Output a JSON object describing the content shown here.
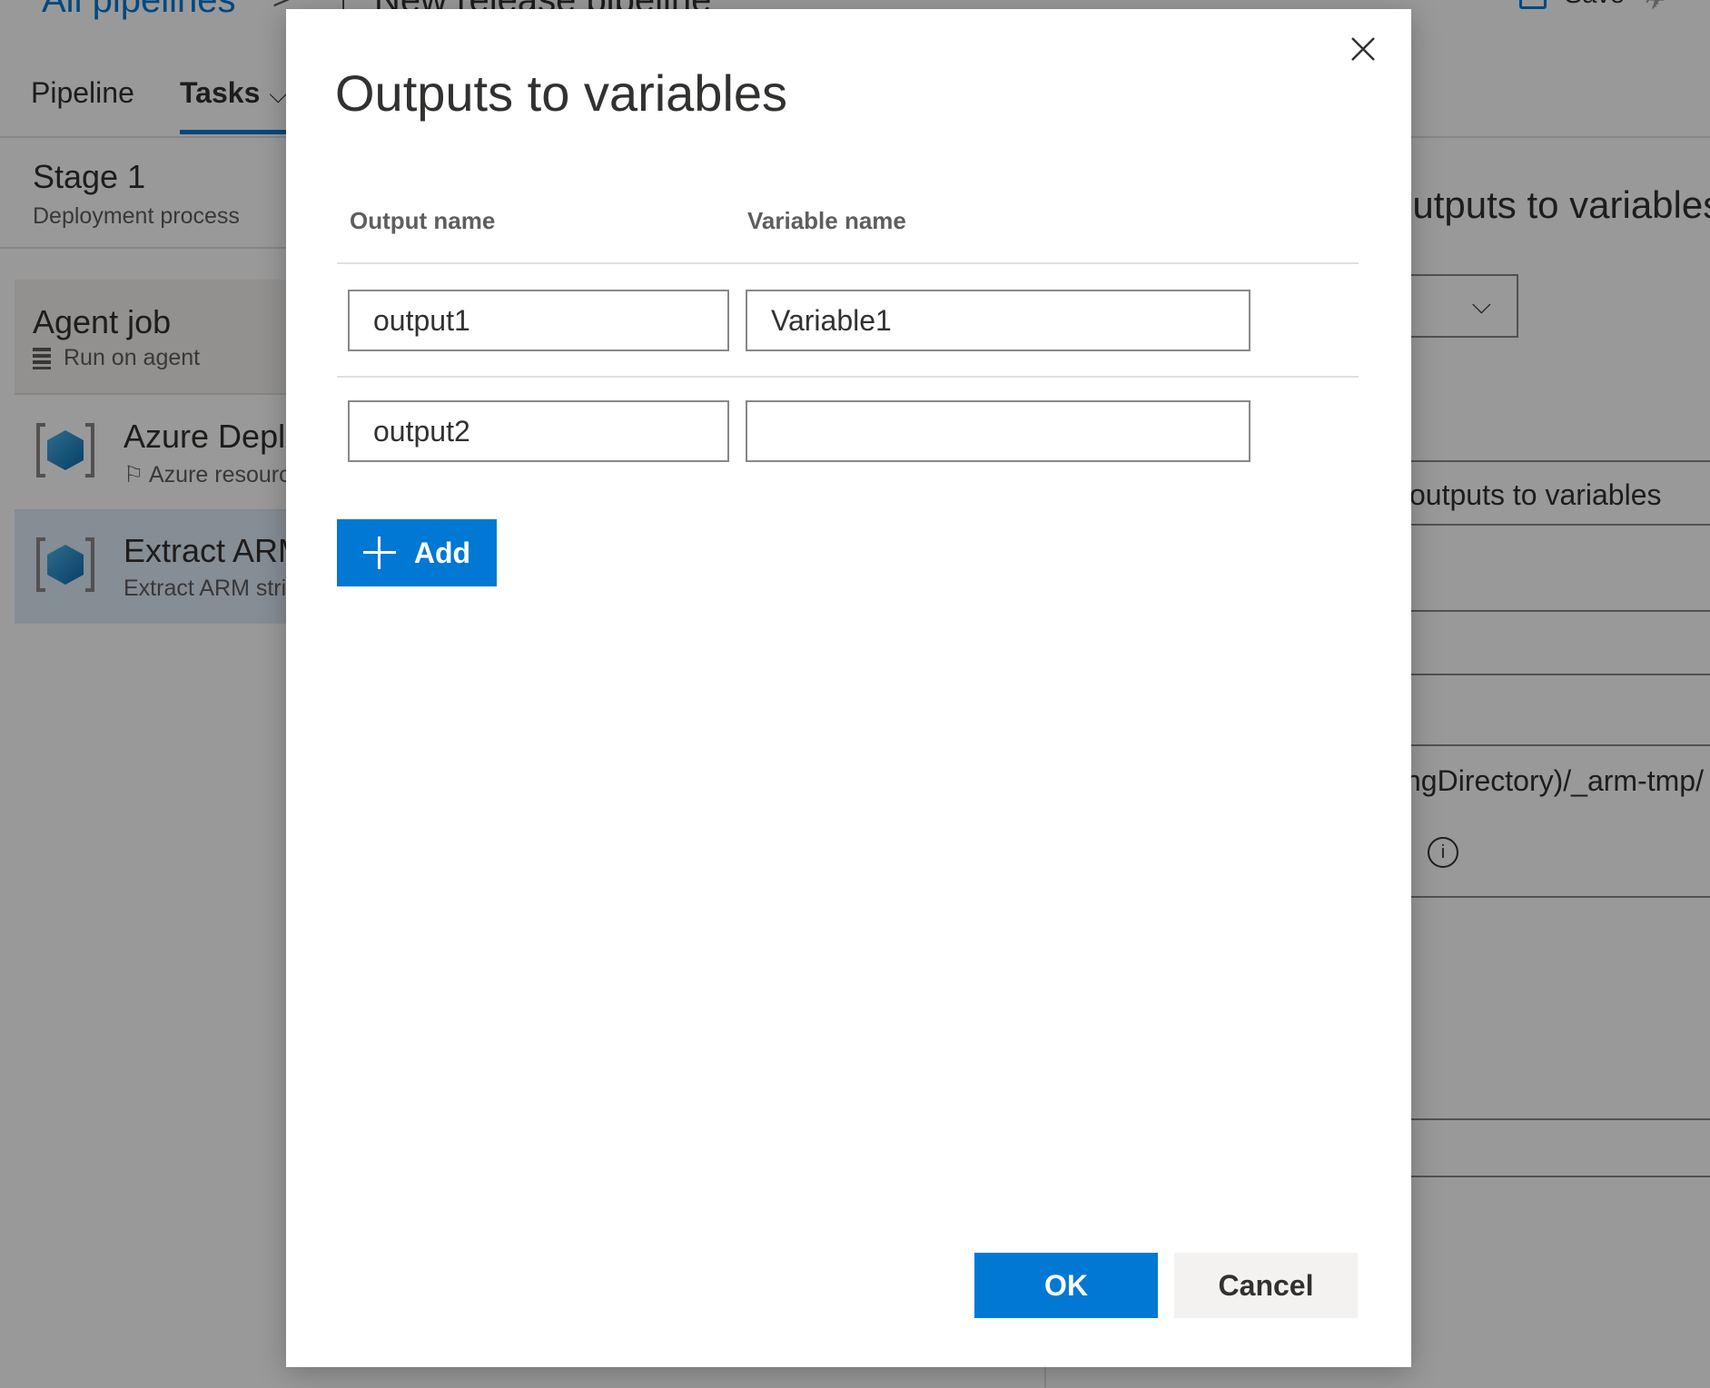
{
  "header": {
    "breadcrumb_root": "All pipelines",
    "breadcrumb_separator": ">",
    "pipeline_title": "New release pipeline",
    "title_icon": "arrow-up-icon",
    "save_label": "Save"
  },
  "tabs": [
    {
      "label": "Pipeline"
    },
    {
      "label": "Tasks"
    }
  ],
  "stage": {
    "title": "Stage 1",
    "subtitle": "Deployment process"
  },
  "agent_job": {
    "title": "Agent job",
    "subtitle": "Run on agent"
  },
  "tasks": [
    {
      "title": "Azure Deployment",
      "subtitle": "Azure resource group deployment",
      "icon": "azure-cube-icon"
    },
    {
      "title": "Extract ARM outputs",
      "subtitle": "Extract ARM strings to variables",
      "icon": "extract-arm-icon"
    }
  ],
  "right_panel": {
    "heading": "outputs to variables",
    "field_label": "outputs to variables",
    "path_value": "ngDirectory)/_arm-tmp/",
    "info_glyph": "i"
  },
  "dialog": {
    "title": "Outputs to variables",
    "columns": {
      "output": "Output name",
      "variable": "Variable name"
    },
    "rows": [
      {
        "output": "output1",
        "variable": "Variable1"
      },
      {
        "output": "output2",
        "variable": ""
      }
    ],
    "add_label": "Add",
    "ok_label": "OK",
    "cancel_label": "Cancel"
  },
  "colors": {
    "accent": "#0078d4",
    "overlay": "rgba(0,0,0,0.4)",
    "selected_task_bg": "#deecf9"
  }
}
